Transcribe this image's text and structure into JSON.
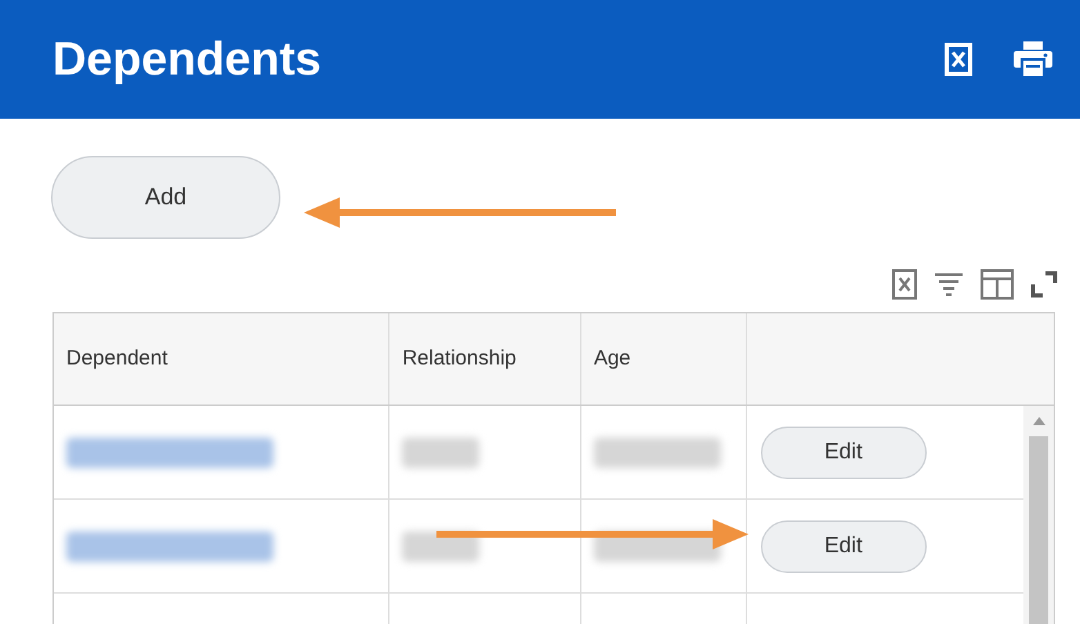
{
  "header": {
    "title": "Dependents"
  },
  "add_button": {
    "label": "Add"
  },
  "table": {
    "columns": [
      "Dependent",
      "Relationship",
      "Age",
      ""
    ],
    "rows": [
      {
        "redacted": true,
        "action": "Edit"
      },
      {
        "redacted": true,
        "action": "Edit"
      },
      {
        "redacted": false,
        "action": ""
      }
    ]
  }
}
